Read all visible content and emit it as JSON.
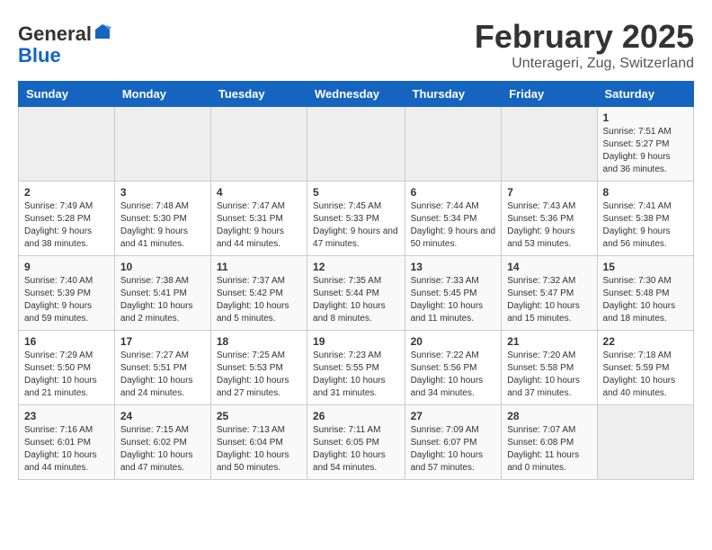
{
  "logo": {
    "general": "General",
    "blue": "Blue"
  },
  "header": {
    "month": "February 2025",
    "location": "Unterageri, Zug, Switzerland"
  },
  "days_of_week": [
    "Sunday",
    "Monday",
    "Tuesday",
    "Wednesday",
    "Thursday",
    "Friday",
    "Saturday"
  ],
  "weeks": [
    [
      {
        "day": "",
        "info": ""
      },
      {
        "day": "",
        "info": ""
      },
      {
        "day": "",
        "info": ""
      },
      {
        "day": "",
        "info": ""
      },
      {
        "day": "",
        "info": ""
      },
      {
        "day": "",
        "info": ""
      },
      {
        "day": "1",
        "info": "Sunrise: 7:51 AM\nSunset: 5:27 PM\nDaylight: 9 hours and 36 minutes."
      }
    ],
    [
      {
        "day": "2",
        "info": "Sunrise: 7:49 AM\nSunset: 5:28 PM\nDaylight: 9 hours and 38 minutes."
      },
      {
        "day": "3",
        "info": "Sunrise: 7:48 AM\nSunset: 5:30 PM\nDaylight: 9 hours and 41 minutes."
      },
      {
        "day": "4",
        "info": "Sunrise: 7:47 AM\nSunset: 5:31 PM\nDaylight: 9 hours and 44 minutes."
      },
      {
        "day": "5",
        "info": "Sunrise: 7:45 AM\nSunset: 5:33 PM\nDaylight: 9 hours and 47 minutes."
      },
      {
        "day": "6",
        "info": "Sunrise: 7:44 AM\nSunset: 5:34 PM\nDaylight: 9 hours and 50 minutes."
      },
      {
        "day": "7",
        "info": "Sunrise: 7:43 AM\nSunset: 5:36 PM\nDaylight: 9 hours and 53 minutes."
      },
      {
        "day": "8",
        "info": "Sunrise: 7:41 AM\nSunset: 5:38 PM\nDaylight: 9 hours and 56 minutes."
      }
    ],
    [
      {
        "day": "9",
        "info": "Sunrise: 7:40 AM\nSunset: 5:39 PM\nDaylight: 9 hours and 59 minutes."
      },
      {
        "day": "10",
        "info": "Sunrise: 7:38 AM\nSunset: 5:41 PM\nDaylight: 10 hours and 2 minutes."
      },
      {
        "day": "11",
        "info": "Sunrise: 7:37 AM\nSunset: 5:42 PM\nDaylight: 10 hours and 5 minutes."
      },
      {
        "day": "12",
        "info": "Sunrise: 7:35 AM\nSunset: 5:44 PM\nDaylight: 10 hours and 8 minutes."
      },
      {
        "day": "13",
        "info": "Sunrise: 7:33 AM\nSunset: 5:45 PM\nDaylight: 10 hours and 11 minutes."
      },
      {
        "day": "14",
        "info": "Sunrise: 7:32 AM\nSunset: 5:47 PM\nDaylight: 10 hours and 15 minutes."
      },
      {
        "day": "15",
        "info": "Sunrise: 7:30 AM\nSunset: 5:48 PM\nDaylight: 10 hours and 18 minutes."
      }
    ],
    [
      {
        "day": "16",
        "info": "Sunrise: 7:29 AM\nSunset: 5:50 PM\nDaylight: 10 hours and 21 minutes."
      },
      {
        "day": "17",
        "info": "Sunrise: 7:27 AM\nSunset: 5:51 PM\nDaylight: 10 hours and 24 minutes."
      },
      {
        "day": "18",
        "info": "Sunrise: 7:25 AM\nSunset: 5:53 PM\nDaylight: 10 hours and 27 minutes."
      },
      {
        "day": "19",
        "info": "Sunrise: 7:23 AM\nSunset: 5:55 PM\nDaylight: 10 hours and 31 minutes."
      },
      {
        "day": "20",
        "info": "Sunrise: 7:22 AM\nSunset: 5:56 PM\nDaylight: 10 hours and 34 minutes."
      },
      {
        "day": "21",
        "info": "Sunrise: 7:20 AM\nSunset: 5:58 PM\nDaylight: 10 hours and 37 minutes."
      },
      {
        "day": "22",
        "info": "Sunrise: 7:18 AM\nSunset: 5:59 PM\nDaylight: 10 hours and 40 minutes."
      }
    ],
    [
      {
        "day": "23",
        "info": "Sunrise: 7:16 AM\nSunset: 6:01 PM\nDaylight: 10 hours and 44 minutes."
      },
      {
        "day": "24",
        "info": "Sunrise: 7:15 AM\nSunset: 6:02 PM\nDaylight: 10 hours and 47 minutes."
      },
      {
        "day": "25",
        "info": "Sunrise: 7:13 AM\nSunset: 6:04 PM\nDaylight: 10 hours and 50 minutes."
      },
      {
        "day": "26",
        "info": "Sunrise: 7:11 AM\nSunset: 6:05 PM\nDaylight: 10 hours and 54 minutes."
      },
      {
        "day": "27",
        "info": "Sunrise: 7:09 AM\nSunset: 6:07 PM\nDaylight: 10 hours and 57 minutes."
      },
      {
        "day": "28",
        "info": "Sunrise: 7:07 AM\nSunset: 6:08 PM\nDaylight: 11 hours and 0 minutes."
      },
      {
        "day": "",
        "info": ""
      }
    ]
  ]
}
